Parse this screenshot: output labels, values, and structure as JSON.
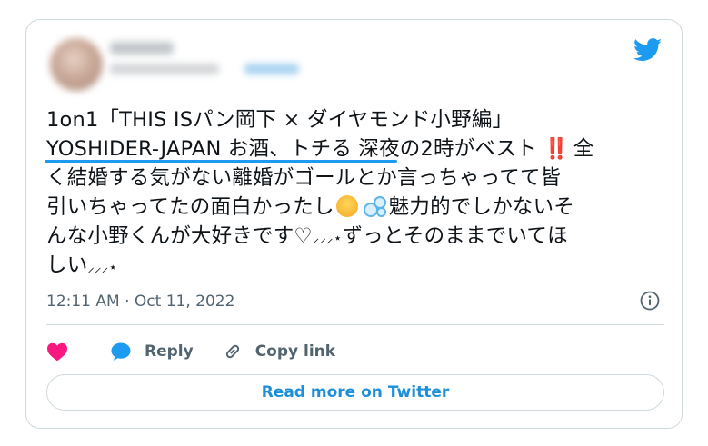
{
  "tweet": {
    "lines": [
      "1on1「THIS ISパン岡下 × ダイヤモンド小野編」",
      "YOSHIDER-JAPAN お酒、トチる 深夜の2時がベスト",
      "全",
      "く結婚する気がない離婚がゴールとか言っちゃってて皆",
      "引いちゃってたの面白かったし",
      "魅力的でしかないそ",
      "んな小野くんが大好きです♡",
      "ずっとそのままでいてほ",
      "しい",
      "‼️",
      "⸝⸝⸝⋆"
    ],
    "timestamp": "12:11 AM · Oct 11, 2022"
  },
  "actions": {
    "reply_label": "Reply",
    "copy_label": "Copy link"
  },
  "read_more_label": "Read more on Twitter",
  "colors": {
    "brand": "#1d9bf0",
    "heart": "#f91880",
    "border": "#cfd9de",
    "muted": "#536471"
  }
}
